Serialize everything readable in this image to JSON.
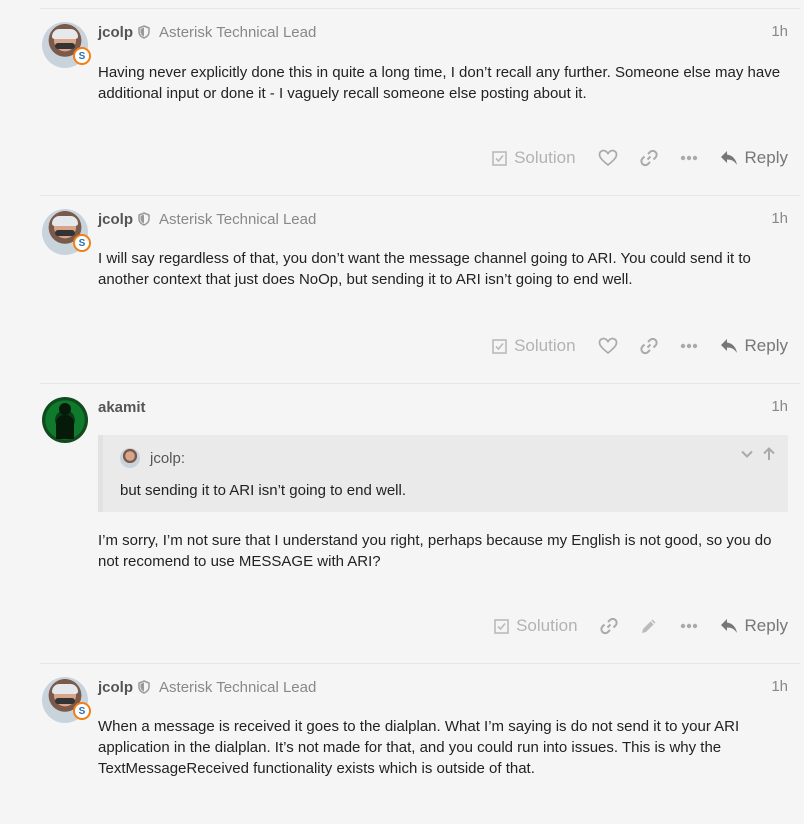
{
  "posts": [
    {
      "username": "jcolp",
      "user_title": "Asterisk Technical Lead",
      "time": "1h",
      "badge": "S",
      "paragraphs": [
        "Having never explicitly done this in quite a long time, I don’t recall any further. Someone else may have additional input or done it - I vaguely recall someone else posting about it."
      ],
      "solution_label": "Solution",
      "reply_label": "Reply"
    },
    {
      "username": "jcolp",
      "user_title": "Asterisk Technical Lead",
      "time": "1h",
      "badge": "S",
      "paragraphs": [
        "I will say regardless of that, you don’t want the message channel going to ARI. You could send it to another context that just does NoOp, but sending it to ARI isn’t going to end well."
      ],
      "solution_label": "Solution",
      "reply_label": "Reply"
    },
    {
      "username": "akamit",
      "time": "1h",
      "quote": {
        "author": "jcolp:",
        "text": "but sending it to ARI isn’t going to end well."
      },
      "paragraphs": [
        "I’m sorry, I’m not sure that I understand you right, perhaps because my English is not good, so you do not recomend to use MESSAGE with ARI?"
      ],
      "solution_label": "Solution",
      "reply_label": "Reply"
    },
    {
      "username": "jcolp",
      "user_title": "Asterisk Technical Lead",
      "time": "1h",
      "badge": "S",
      "paragraphs": [
        "When a message is received it goes to the dialplan. What I’m saying is do not send it to your ARI application in the dialplan. It’s not made for that, and you could run into issues. This is why the TextMessageReceived functionality exists which is outside of that."
      ]
    }
  ]
}
